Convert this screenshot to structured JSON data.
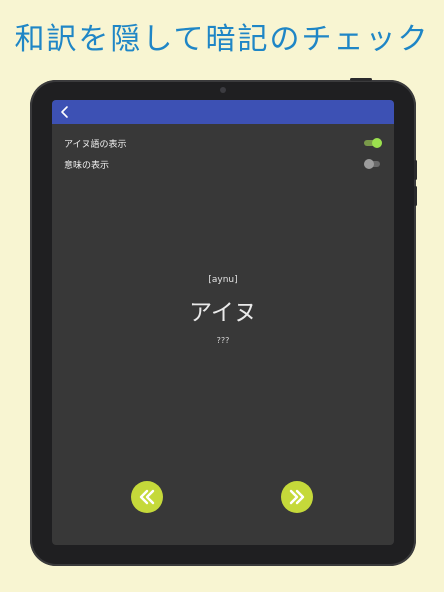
{
  "headline": "和訳を隠して暗記のチェック",
  "appbar": {
    "back_icon": "chevron-left-icon"
  },
  "settings": [
    {
      "label": "アイヌ語の表示",
      "toggle": "on"
    },
    {
      "label": "意味の表示",
      "toggle": "off"
    }
  ],
  "card": {
    "pronunciation": "[aynu]",
    "word": "アイヌ",
    "meaning": "???"
  },
  "navigation": {
    "prev_icon": "double-chevron-left-icon",
    "next_icon": "double-chevron-right-icon"
  },
  "colors": {
    "background": "#f8f5d2",
    "headline": "#1f86c6",
    "appbar": "#3d51b4",
    "screen": "#383838",
    "toggle_on": "#9be04e",
    "nav_button": "#c5d93a"
  }
}
